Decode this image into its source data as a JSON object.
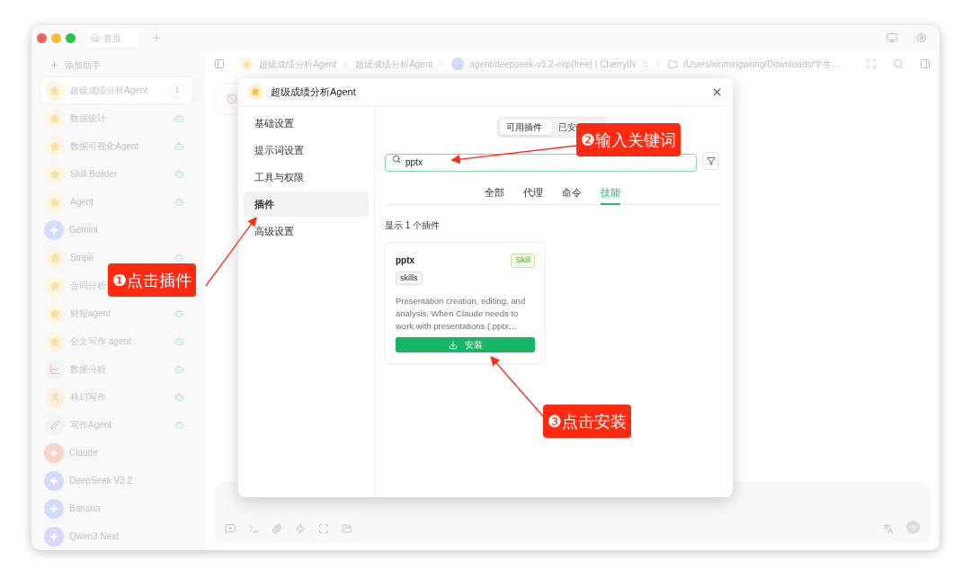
{
  "window": {
    "tab": "首页"
  },
  "sidebar": {
    "add_label": "添加助手",
    "items": [
      {
        "name": "超级成绩分析Agent",
        "kind": "star",
        "selected": true,
        "badge": "1"
      },
      {
        "name": "数据统计",
        "kind": "star",
        "selected": false
      },
      {
        "name": "数据可视化Agent",
        "kind": "star",
        "selected": false
      },
      {
        "name": "Skill Builder",
        "kind": "star",
        "selected": false
      },
      {
        "name": "Agent",
        "kind": "star",
        "selected": false
      },
      {
        "name": "Gemini",
        "kind": "model",
        "selected": false,
        "color": "#d3ddfc"
      },
      {
        "name": "Stripe",
        "kind": "star",
        "selected": false
      },
      {
        "name": "合同分析",
        "kind": "star",
        "selected": false
      },
      {
        "name": "财报agent",
        "kind": "star",
        "selected": false
      },
      {
        "name": "公文写作 agent",
        "kind": "star",
        "selected": false
      },
      {
        "name": "数据分析",
        "kind": "chart",
        "selected": false
      },
      {
        "name": "科幻写作",
        "kind": "figure",
        "selected": false
      },
      {
        "name": "写作Agent",
        "kind": "pen",
        "selected": false
      },
      {
        "name": "Claude",
        "kind": "model",
        "selected": false,
        "color": "#f9d3c6"
      },
      {
        "name": "DeepSeek V3.2",
        "kind": "model",
        "selected": false,
        "color": "#d3d9fb"
      },
      {
        "name": "Banana",
        "kind": "model",
        "selected": false,
        "color": "#cfdcfc"
      },
      {
        "name": "Qwen3 Next",
        "kind": "model",
        "selected": false,
        "color": "#ddd5fb"
      }
    ]
  },
  "header": {
    "breadcrumbs": [
      "超级成绩分析Agent",
      "超级成绩分析Agent"
    ],
    "model": "agent/deepseek-v3.2-exp(free) | CherryIN",
    "path": "/Users/xinmingwong/Downloads/学生..."
  },
  "dialog": {
    "title": "超级成绩分析Agent",
    "nav": [
      {
        "label": "基础设置",
        "selected": false
      },
      {
        "label": "提示词设置",
        "selected": false
      },
      {
        "label": "工具与权限",
        "selected": false
      },
      {
        "label": "插件",
        "selected": true
      },
      {
        "label": "高级设置",
        "selected": false
      }
    ],
    "segments": [
      {
        "label": "可用插件",
        "selected": true
      },
      {
        "label": "已安",
        "selected": false
      }
    ],
    "search": {
      "value": "pptx"
    },
    "filters": [
      {
        "label": "全部",
        "selected": false
      },
      {
        "label": "代理",
        "selected": false
      },
      {
        "label": "命令",
        "selected": false
      },
      {
        "label": "技能",
        "selected": true
      }
    ],
    "count": "显示 1 个插件",
    "plugins": [
      {
        "name": "pptx",
        "badge": "Skill",
        "tag": "skills",
        "description": "Presentation creation, editing, and analysis. When Claude needs to work with presentations (.pptx…",
        "button": "安装"
      }
    ]
  },
  "annotations": [
    {
      "text": "❶点击插件"
    },
    {
      "text": "❷输入关键词"
    },
    {
      "text": "❸点击安装"
    }
  ]
}
